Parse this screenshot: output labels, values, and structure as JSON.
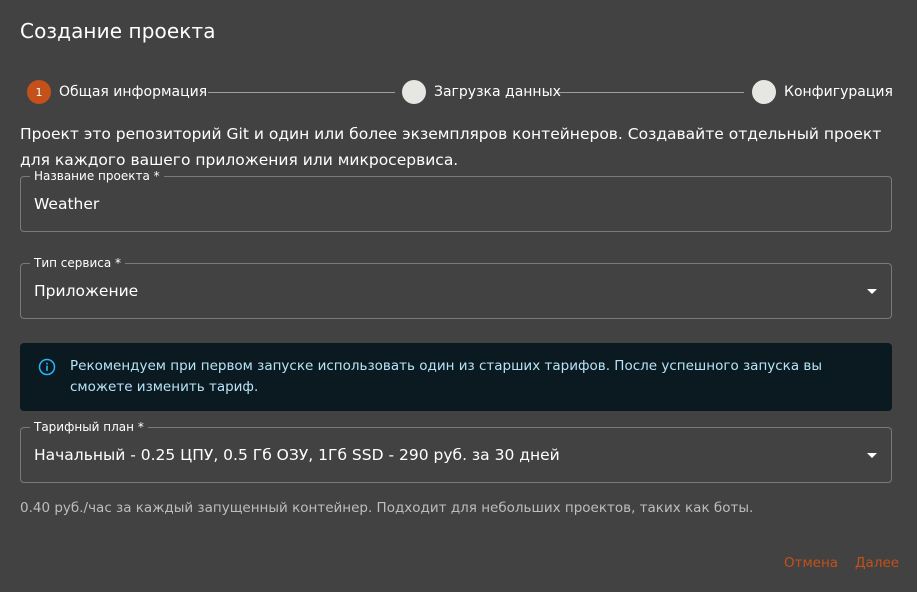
{
  "dialog": {
    "title": "Создание проекта"
  },
  "stepper": {
    "steps": [
      {
        "number": "1",
        "label": "Общая информация",
        "active": true
      },
      {
        "number": "",
        "label": "Загрузка данных",
        "active": false
      },
      {
        "number": "",
        "label": "Конфигурация",
        "active": false
      }
    ]
  },
  "description": "Проект это репозиторий Git и один или более экземпляров контейнеров. Создавайте отдельный проект для каждого вашего приложения или микросервиса.",
  "form": {
    "project_name": {
      "label": "Название проекта *",
      "value": "Weather"
    },
    "service_type": {
      "label": "Тип сервиса *",
      "value": "Приложение"
    },
    "tariff": {
      "label": "Тарифный план *",
      "value": "Начальный - 0.25 ЦПУ, 0.5 Гб ОЗУ, 1Гб SSD - 290 руб. за 30 дней"
    }
  },
  "alert": {
    "icon": "info-icon",
    "text": "Рекомендуем при первом запуске использовать один из старших тарифов. После успешного запуска вы сможете изменить тариф."
  },
  "helper_text": "0.40 руб./час за каждый запущенный контейнер. Подходит для небольших проектов, таких как боты.",
  "actions": {
    "cancel_label": "Отмена",
    "next_label": "Далее"
  },
  "colors": {
    "accent": "#c4501a",
    "background": "#424242",
    "alert_bg": "#0b1a21",
    "alert_text": "#b8e3f6"
  }
}
